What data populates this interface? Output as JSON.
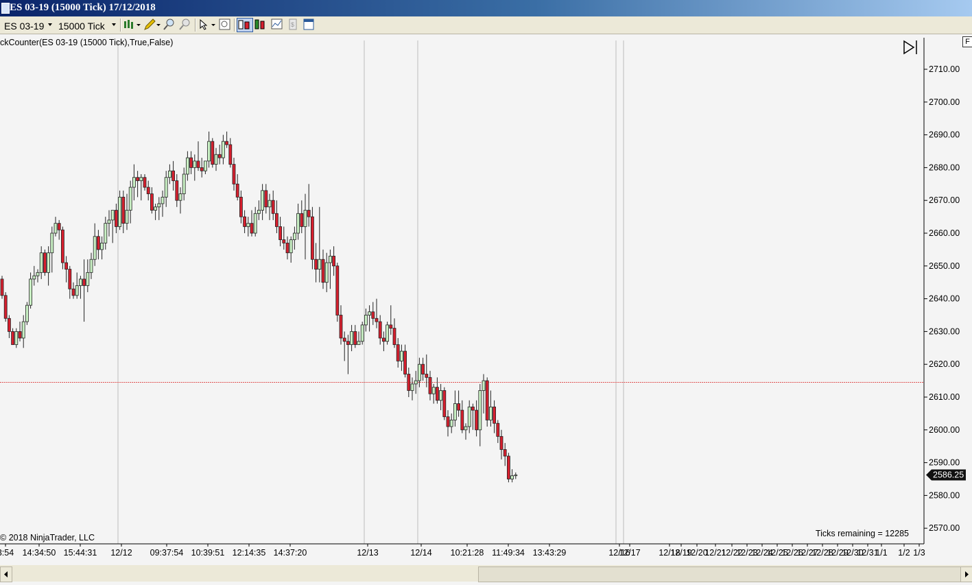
{
  "window": {
    "title": "ES 03-19 (15000 Tick)  17/12/2018"
  },
  "toolbar": {
    "instrument": "ES 03-19",
    "period": "15000 Tick",
    "icons": [
      "bar-type-icon",
      "drawing-pencil-icon",
      "zoom-in-icon",
      "zoom-out-icon",
      "cursor-select-icon",
      "properties-icon",
      "chart-style-candles-icon",
      "chart-style-bars-icon",
      "data-box-icon",
      "strategies-icon",
      "indicators-icon"
    ]
  },
  "indicator_label": "ckCounter(ES  03-19 (15000  Tick),True,False)",
  "copyright": "2018 NinjaTrader, LLC",
  "ticks_remaining": "Ticks remaining = 12285",
  "f_button": "F",
  "colors": {
    "up": "#c9f0c4",
    "down": "#d61f2e",
    "wick": "#222222",
    "price_line": "#e05050",
    "background": "#f4f4f4"
  },
  "chart_data": {
    "type": "candlestick",
    "y_axis": {
      "min": 2565,
      "max": 2716,
      "ticks": [
        2710,
        2700,
        2690,
        2680,
        2670,
        2660,
        2650,
        2640,
        2630,
        2620,
        2610,
        2600,
        2590,
        2580,
        2570
      ],
      "tick_format": "2 decimals"
    },
    "last_price": 2586.25,
    "last_price_label": "2586.25",
    "price_line_level": 2614.5,
    "x_labels": [
      "3:54",
      "14:34:50",
      "15:44:31",
      "12/12",
      "09:37:54",
      "10:39:51",
      "12:14:35",
      "14:37:20",
      "12/13",
      "12/14",
      "10:21:28",
      "11:49:34",
      "13:43:29",
      "12/16",
      "12/17",
      "12/18",
      "12/19",
      "12/20",
      "12/21",
      "12/22",
      "12/23",
      "12/24",
      "12/25",
      "12/26",
      "12/27",
      "12/28",
      "12/29",
      "12/30",
      "12/31",
      "1/1",
      "1/2",
      "1/3"
    ],
    "session_breaks": [
      "12/12",
      "12/13",
      "12/14",
      "12/16",
      "12/17"
    ],
    "candles": [
      [
        2646,
        2647,
        2640,
        2641
      ],
      [
        2641,
        2642,
        2633,
        2634
      ],
      [
        2634,
        2635,
        2628,
        2630
      ],
      [
        2630,
        2631,
        2626,
        2626
      ],
      [
        2626,
        2631,
        2625,
        2630
      ],
      [
        2630,
        2633,
        2627,
        2628
      ],
      [
        2628,
        2635,
        2625,
        2633
      ],
      [
        2633,
        2639,
        2632,
        2638
      ],
      [
        2638,
        2648,
        2637,
        2646
      ],
      [
        2646,
        2650,
        2644,
        2647
      ],
      [
        2647,
        2649,
        2645,
        2648
      ],
      [
        2648,
        2656,
        2646,
        2654
      ],
      [
        2654,
        2655,
        2647,
        2648
      ],
      [
        2648,
        2656,
        2644,
        2654
      ],
      [
        2654,
        2662,
        2648,
        2660
      ],
      [
        2660,
        2665,
        2659,
        2663
      ],
      [
        2663,
        2664,
        2658,
        2661
      ],
      [
        2661,
        2662,
        2649,
        2651
      ],
      [
        2651,
        2653,
        2645,
        2649
      ],
      [
        2649,
        2650,
        2640,
        2643
      ],
      [
        2643,
        2645,
        2640,
        2641
      ],
      [
        2641,
        2648,
        2640,
        2644
      ],
      [
        2644,
        2647,
        2640,
        2646
      ],
      [
        2646,
        2652,
        2633,
        2644
      ],
      [
        2644,
        2652,
        2642,
        2648
      ],
      [
        2648,
        2654,
        2646,
        2652
      ],
      [
        2652,
        2663,
        2650,
        2659
      ],
      [
        2659,
        2661,
        2652,
        2655
      ],
      [
        2655,
        2659,
        2652,
        2657
      ],
      [
        2657,
        2665,
        2655,
        2663
      ],
      [
        2663,
        2667,
        2659,
        2664
      ],
      [
        2664,
        2666,
        2657,
        2667
      ],
      [
        2667,
        2669,
        2660,
        2662
      ],
      [
        2662,
        2673,
        2661,
        2671
      ],
      [
        2671,
        2673,
        2660,
        2663
      ],
      [
        2663,
        2672,
        2661,
        2667
      ],
      [
        2667,
        2676,
        2663,
        2674
      ],
      [
        2674,
        2681,
        2670,
        2677
      ],
      [
        2677,
        2679,
        2671,
        2676
      ],
      [
        2676,
        2678,
        2670,
        2677
      ],
      [
        2677,
        2678,
        2673,
        2674
      ],
      [
        2674,
        2676,
        2670,
        2672
      ],
      [
        2672,
        2674,
        2666,
        2667
      ],
      [
        2667,
        2669,
        2664,
        2668
      ],
      [
        2668,
        2671,
        2664,
        2669
      ],
      [
        2669,
        2673,
        2665,
        2671
      ],
      [
        2671,
        2679,
        2668,
        2677
      ],
      [
        2677,
        2681,
        2675,
        2679
      ],
      [
        2679,
        2682,
        2673,
        2676
      ],
      [
        2676,
        2678,
        2668,
        2670
      ],
      [
        2670,
        2674,
        2666,
        2672
      ],
      [
        2672,
        2680,
        2670,
        2678
      ],
      [
        2678,
        2685,
        2676,
        2683
      ],
      [
        2683,
        2685,
        2678,
        2680
      ],
      [
        2680,
        2684,
        2676,
        2682
      ],
      [
        2682,
        2688,
        2679,
        2680
      ],
      [
        2680,
        2683,
        2677,
        2679
      ],
      [
        2679,
        2682,
        2678,
        2682
      ],
      [
        2682,
        2691,
        2680,
        2688
      ],
      [
        2688,
        2689,
        2680,
        2681
      ],
      [
        2681,
        2686,
        2679,
        2684
      ],
      [
        2684,
        2687,
        2681,
        2683
      ],
      [
        2683,
        2690,
        2681,
        2688
      ],
      [
        2688,
        2691,
        2686,
        2687
      ],
      [
        2687,
        2689,
        2680,
        2681
      ],
      [
        2681,
        2683,
        2673,
        2675
      ],
      [
        2675,
        2678,
        2670,
        2671
      ],
      [
        2671,
        2673,
        2663,
        2665
      ],
      [
        2665,
        2667,
        2660,
        2662
      ],
      [
        2662,
        2665,
        2659,
        2663
      ],
      [
        2663,
        2667,
        2659,
        2660
      ],
      [
        2660,
        2668,
        2659,
        2666
      ],
      [
        2666,
        2670,
        2664,
        2667
      ],
      [
        2667,
        2675,
        2664,
        2673
      ],
      [
        2673,
        2675,
        2666,
        2668
      ],
      [
        2668,
        2672,
        2664,
        2670
      ],
      [
        2670,
        2673,
        2664,
        2666
      ],
      [
        2666,
        2670,
        2660,
        2662
      ],
      [
        2662,
        2665,
        2656,
        2658
      ],
      [
        2658,
        2662,
        2655,
        2657
      ],
      [
        2657,
        2659,
        2652,
        2654
      ],
      [
        2654,
        2659,
        2651,
        2658
      ],
      [
        2658,
        2662,
        2655,
        2660
      ],
      [
        2660,
        2669,
        2658,
        2666
      ],
      [
        2666,
        2670,
        2660,
        2662
      ],
      [
        2662,
        2672,
        2652,
        2667
      ],
      [
        2667,
        2675,
        2662,
        2665
      ],
      [
        2665,
        2668,
        2649,
        2652
      ],
      [
        2652,
        2657,
        2645,
        2649
      ],
      [
        2649,
        2668,
        2645,
        2652
      ],
      [
        2652,
        2655,
        2643,
        2645
      ],
      [
        2645,
        2654,
        2642,
        2651
      ],
      [
        2651,
        2655,
        2643,
        2653
      ],
      [
        2653,
        2656,
        2647,
        2650
      ],
      [
        2650,
        2651,
        2633,
        2635
      ],
      [
        2635,
        2638,
        2626,
        2628
      ],
      [
        2628,
        2630,
        2621,
        2627
      ],
      [
        2627,
        2629,
        2617,
        2626
      ],
      [
        2626,
        2632,
        2624,
        2630
      ],
      [
        2630,
        2632,
        2625,
        2626
      ],
      [
        2626,
        2630,
        2626,
        2627
      ],
      [
        2627,
        2633,
        2626,
        2632
      ],
      [
        2632,
        2637,
        2630,
        2635
      ],
      [
        2635,
        2638,
        2630,
        2636
      ],
      [
        2636,
        2639,
        2632,
        2634
      ],
      [
        2634,
        2640,
        2631,
        2633
      ],
      [
        2633,
        2635,
        2626,
        2628
      ],
      [
        2628,
        2630,
        2624,
        2627
      ],
      [
        2627,
        2633,
        2626,
        2632
      ],
      [
        2632,
        2638,
        2629,
        2631
      ],
      [
        2631,
        2634,
        2625,
        2626
      ],
      [
        2626,
        2628,
        2619,
        2621
      ],
      [
        2621,
        2626,
        2618,
        2624
      ],
      [
        2624,
        2626,
        2616,
        2617
      ],
      [
        2617,
        2619,
        2610,
        2612
      ],
      [
        2612,
        2616,
        2609,
        2614
      ],
      [
        2614,
        2618,
        2611,
        2615
      ],
      [
        2615,
        2622,
        2613,
        2620
      ],
      [
        2620,
        2622,
        2615,
        2617
      ],
      [
        2617,
        2623,
        2613,
        2616
      ],
      [
        2616,
        2618,
        2609,
        2611
      ],
      [
        2611,
        2614,
        2608,
        2613
      ],
      [
        2613,
        2616,
        2608,
        2609
      ],
      [
        2609,
        2614,
        2606,
        2612
      ],
      [
        2612,
        2613,
        2603,
        2604
      ],
      [
        2604,
        2606,
        2598,
        2601
      ],
      [
        2601,
        2605,
        2599,
        2603
      ],
      [
        2603,
        2612,
        2601,
        2608
      ],
      [
        2608,
        2612,
        2604,
        2606
      ],
      [
        2606,
        2609,
        2599,
        2600
      ],
      [
        2600,
        2602,
        2597,
        2601
      ],
      [
        2601,
        2609,
        2599,
        2607
      ],
      [
        2607,
        2608,
        2600,
        2606
      ],
      [
        2606,
        2609,
        2598,
        2600
      ],
      [
        2600,
        2614,
        2595,
        2612
      ],
      [
        2612,
        2617,
        2605,
        2615
      ],
      [
        2615,
        2616,
        2601,
        2603
      ],
      [
        2603,
        2612,
        2601,
        2607
      ],
      [
        2607,
        2609,
        2599,
        2602
      ],
      [
        2602,
        2603,
        2596,
        2598
      ],
      [
        2598,
        2600,
        2591,
        2594
      ],
      [
        2594,
        2596,
        2589,
        2592
      ],
      [
        2592,
        2593,
        2584,
        2585
      ],
      [
        2585,
        2588,
        2584,
        2586
      ],
      [
        2586,
        2587,
        2585,
        2586.25
      ]
    ]
  }
}
